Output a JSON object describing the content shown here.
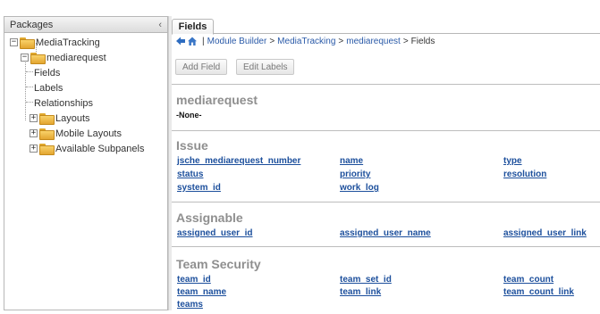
{
  "left_panel": {
    "title": "Packages",
    "collapse_glyph": "‹",
    "tree": {
      "root": "MediaTracking",
      "module": "mediarequest",
      "children": [
        "Fields",
        "Labels",
        "Relationships"
      ],
      "groups": [
        "Layouts",
        "Mobile Layouts",
        "Available Subpanels"
      ]
    }
  },
  "tab": {
    "label": "Fields"
  },
  "breadcrumb": {
    "items": [
      "Module Builder",
      "MediaTracking",
      "mediarequest",
      "Fields"
    ],
    "separator": ">",
    "divider": "|"
  },
  "toolbar": {
    "add_field": "Add Field",
    "edit_labels": "Edit Labels"
  },
  "sections": {
    "module": {
      "title": "mediarequest",
      "none": "-None-"
    },
    "issue": {
      "title": "Issue",
      "rows": [
        [
          "jsche_mediarequest_number",
          "name",
          "type"
        ],
        [
          "status",
          "priority",
          "resolution"
        ],
        [
          "system_id",
          "work_log",
          ""
        ]
      ]
    },
    "assignable": {
      "title": "Assignable",
      "rows": [
        [
          "assigned_user_id",
          "assigned_user_name",
          "assigned_user_link"
        ]
      ]
    },
    "team_security": {
      "title": "Team Security",
      "rows": [
        [
          "team_id",
          "team_set_id",
          "team_count"
        ],
        [
          "team_name",
          "team_link",
          "team_count_link"
        ],
        [
          "teams",
          "",
          ""
        ]
      ]
    }
  },
  "icons": [
    "folder-icon",
    "back-arrow-icon",
    "home-icon",
    "tree-expand-icon"
  ],
  "colors": {
    "link": "#1c4f9c",
    "section_title": "#8f8f8f",
    "folder": "#e3a630"
  }
}
